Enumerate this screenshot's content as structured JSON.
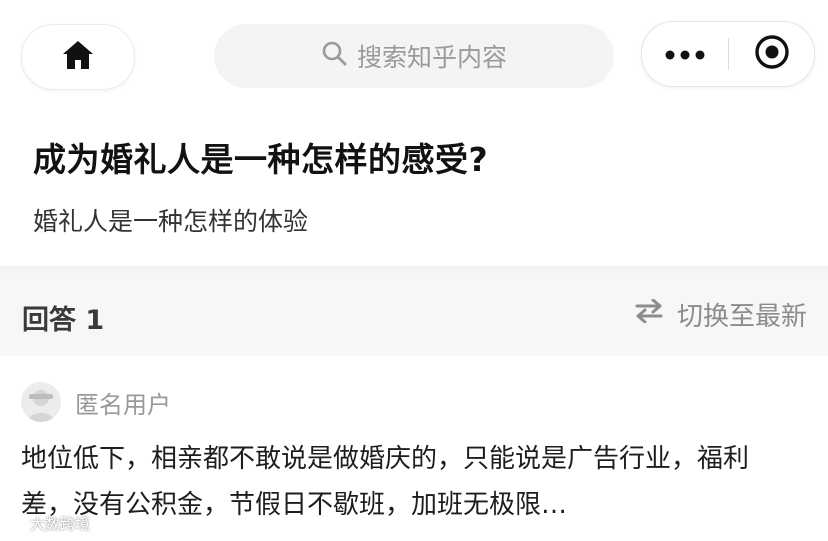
{
  "topbar": {
    "home_icon": "home-icon",
    "search_icon": "search-icon",
    "search_placeholder": "搜索知乎内容",
    "more_icon": "more-dots-icon",
    "close_icon": "close-miniprogram-icon"
  },
  "question": {
    "title": "成为婚礼人是一种怎样的感受?",
    "subtitle": "婚礼人是一种怎样的体验"
  },
  "answers_header": {
    "count_label": "回答 1",
    "switch_icon": "swap-icon",
    "switch_label": "切换至最新"
  },
  "answer": {
    "author_name": "匿名用户",
    "avatar_icon": "anonymous-avatar-icon",
    "text": "地位低下，相亲都不敢说是做婚庆的，只能说是广告行业，福利差，没有公积金，节假日不歇班，加班无极限…"
  },
  "watermark": {
    "text": "大数跨境"
  },
  "colors": {
    "background": "#ffffff",
    "section_gray": "#f7f7f7",
    "muted_text": "#8c8c8c",
    "title_text": "#121212"
  }
}
